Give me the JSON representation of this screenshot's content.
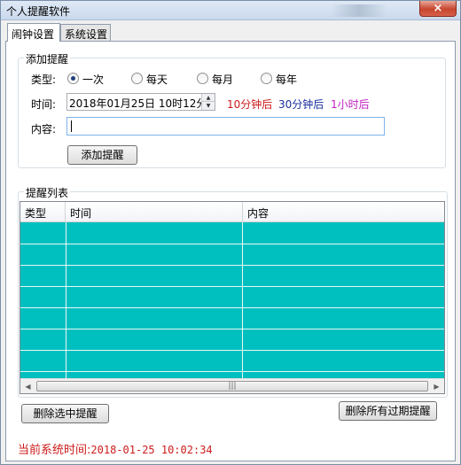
{
  "window": {
    "title": "个人提醒软件",
    "close_label": "×"
  },
  "tabs": [
    {
      "label": "闹钟设置",
      "active": true
    },
    {
      "label": "系统设置",
      "active": false
    }
  ],
  "add_group": {
    "title": "添加提醒",
    "type_label": "类型:",
    "type_options": [
      {
        "label": "一次",
        "checked": true
      },
      {
        "label": "每天",
        "checked": false
      },
      {
        "label": "每月",
        "checked": false
      },
      {
        "label": "每年",
        "checked": false
      }
    ],
    "time_label": "时间:",
    "time_value": "2018年01月25日 10时12分",
    "quick_times": [
      {
        "label": "10分钟后",
        "color": "#cc1b1b"
      },
      {
        "label": "30分钟后",
        "color": "#1a2f9c"
      },
      {
        "label": "1小时后",
        "color": "#c01fc0"
      }
    ],
    "content_label": "内容:",
    "content_value": "",
    "add_button": "添加提醒"
  },
  "list_group": {
    "title": "提醒列表",
    "columns": [
      "类型",
      "时间",
      "内容"
    ],
    "rows": [],
    "grid_color": "#00bfbf"
  },
  "buttons": {
    "delete_selected": "删除选中提醒",
    "delete_expired": "删除所有过期提醒"
  },
  "status": {
    "label": "当前系统时间:",
    "time": "2018-01-25 10:02:34",
    "color": "#cc1b1b"
  }
}
